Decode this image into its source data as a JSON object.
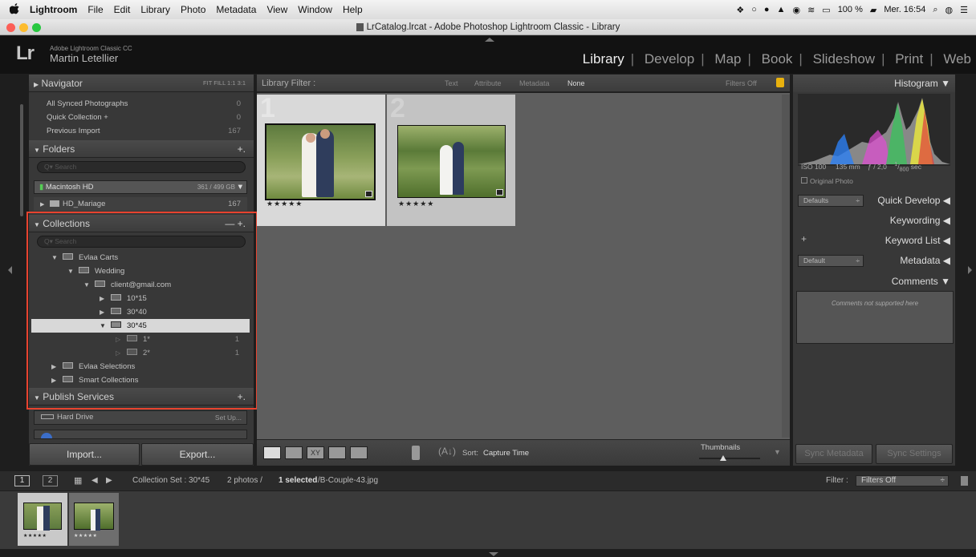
{
  "menubar": {
    "apple": "",
    "app": "Lightroom",
    "items": [
      "File",
      "Edit",
      "Library",
      "Photo",
      "Metadata",
      "View",
      "Window",
      "Help"
    ],
    "battery": "100 %",
    "clock": "Mer. 16:54"
  },
  "window": {
    "title": "LrCatalog.lrcat - Adobe Photoshop Lightroom Classic - Library"
  },
  "identity": {
    "logo": "Lr",
    "product": "Adobe Lightroom Classic CC",
    "user": "Martin Letellier"
  },
  "modules": [
    "Library",
    "Develop",
    "Map",
    "Book",
    "Slideshow",
    "Print",
    "Web"
  ],
  "left": {
    "navigator": {
      "label": "Navigator",
      "zoom": "FIT  FILL  1:1  3:1"
    },
    "catalog": [
      {
        "label": "All Synced Photographs",
        "count": "0"
      },
      {
        "label": "Quick Collection +",
        "count": "0"
      },
      {
        "label": "Previous Import",
        "count": "167"
      }
    ],
    "folders": {
      "label": "Folders",
      "search": "Search",
      "volume": "Macintosh HD",
      "volume_size": "361 / 499 GB",
      "folder": "HD_Mariage",
      "folder_count": "167"
    },
    "collections": {
      "label": "Collections",
      "search": "Search",
      "items": [
        {
          "label": "Evlaa Carts",
          "count": ""
        },
        {
          "label": "Wedding",
          "count": ""
        },
        {
          "label": "client@gmail.com",
          "count": ""
        },
        {
          "label": "10*15",
          "count": ""
        },
        {
          "label": "30*40",
          "count": ""
        },
        {
          "label": "30*45",
          "count": ""
        },
        {
          "label": "1*",
          "count": "1"
        },
        {
          "label": "2*",
          "count": "1"
        },
        {
          "label": "Evlaa Selections",
          "count": ""
        },
        {
          "label": "Smart Collections",
          "count": ""
        }
      ]
    },
    "publish": {
      "label": "Publish Services",
      "hard_drive": "Hard Drive",
      "setup": "Set Up..."
    },
    "import_label": "Import...",
    "export_label": "Export..."
  },
  "filterbar": {
    "label": "Library Filter :",
    "text": "Text",
    "attribute": "Attribute",
    "metadata": "Metadata",
    "none": "None",
    "filters_off": "Filters Off"
  },
  "grid": [
    {
      "index": "1",
      "stars": "★★★★★"
    },
    {
      "index": "2",
      "stars": "★★★★★"
    }
  ],
  "toolbar": {
    "sort_label": "Sort:",
    "sort_value": "Capture Time",
    "thumbnails": "Thumbnails"
  },
  "right": {
    "histogram": "Histogram",
    "iso": "ISO 100",
    "focal": "135 mm",
    "aperture": "ƒ / 2,0",
    "shutter_num": "1",
    "shutter_den": "800",
    "shutter_unit": "sec",
    "original_photo": "Original Photo",
    "defaults": "Defaults",
    "quick_develop": "Quick Develop",
    "keywording": "Keywording",
    "keyword_list": "Keyword List",
    "default": "Default",
    "metadata": "Metadata",
    "comments": "Comments",
    "comments_note": "Comments not supported here",
    "sync_metadata": "Sync Metadata",
    "sync_settings": "Sync Settings"
  },
  "filmstrip": {
    "page1": "1",
    "page2": "2",
    "source": "Collection Set : 30*45",
    "count": "2 photos /",
    "selected": "1 selected",
    "file": "/B-Couple-43.jpg",
    "filter_label": "Filter :",
    "filter_value": "Filters Off",
    "stars": "★★★★★"
  },
  "accent": "#e8432f"
}
